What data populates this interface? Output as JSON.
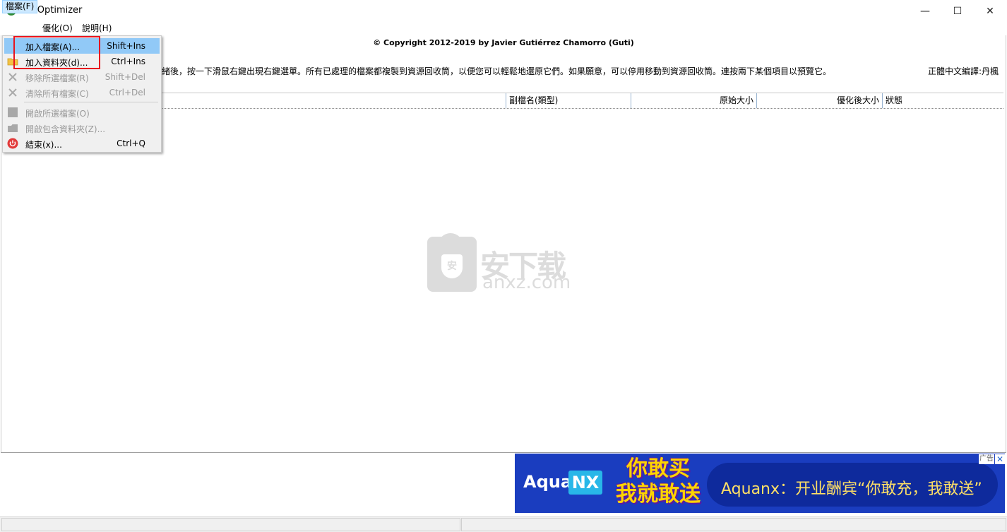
{
  "window": {
    "title": "FileOptimizer",
    "minimize": "—",
    "maximize": "☐",
    "close": "✕"
  },
  "menubar": [
    {
      "label": "檔案(F)"
    },
    {
      "label": "優化(O)"
    },
    {
      "label": "說明(H)"
    }
  ],
  "content": {
    "copyright": "© Copyright 2012-2019 by Javier Gutiérrez Chamorro (Guti)",
    "instructions": "緒後，按一下滑鼠右鍵出現右鍵選單。所有已處理的檔案都複製到資源回收筒，以便您可以輕鬆地還原它們。如果願意，可以停用移動到資源回收筒。連按兩下某個項目以預覽它。",
    "translator": "正體中文編譯:丹楓"
  },
  "list": {
    "columns": [
      {
        "label": "副檔名(類型)"
      },
      {
        "label": "原始大小"
      },
      {
        "label": "優化後大小"
      },
      {
        "label": "狀態"
      }
    ]
  },
  "file_menu": {
    "items": [
      {
        "label": "加入檔案(A)...",
        "shortcut": "Shift+Ins",
        "enabled": true
      },
      {
        "label": "加入資料夾(d)...",
        "shortcut": "Ctrl+Ins",
        "enabled": true
      },
      {
        "label": "移除所選檔案(R)",
        "shortcut": "Shift+Del",
        "enabled": false
      },
      {
        "label": "清除所有檔案(C)",
        "shortcut": "Ctrl+Del",
        "enabled": false
      },
      {
        "label": "開啟所選檔案(O)",
        "shortcut": "",
        "enabled": false
      },
      {
        "label": "開啟包含資料夾(Z)...",
        "shortcut": "",
        "enabled": false
      },
      {
        "label": "結束(x)...",
        "shortcut": "Ctrl+Q",
        "enabled": true
      }
    ]
  },
  "watermark": {
    "glyph": "安",
    "cn": "安下载",
    "en": "anxz.com"
  },
  "ad": {
    "brand1": "Aqua",
    "brand2": "NX",
    "promo_line1": "你敢买",
    "promo_line2": "我就敢送",
    "text": "Aquanx：开业酬宾“你敢充，我敢送”",
    "tag": "广告",
    "close": "✕"
  },
  "colors": {
    "highlight": "#91c9f7",
    "annotation_box": "#e8141e",
    "ad_background": "#1a3dbf"
  }
}
